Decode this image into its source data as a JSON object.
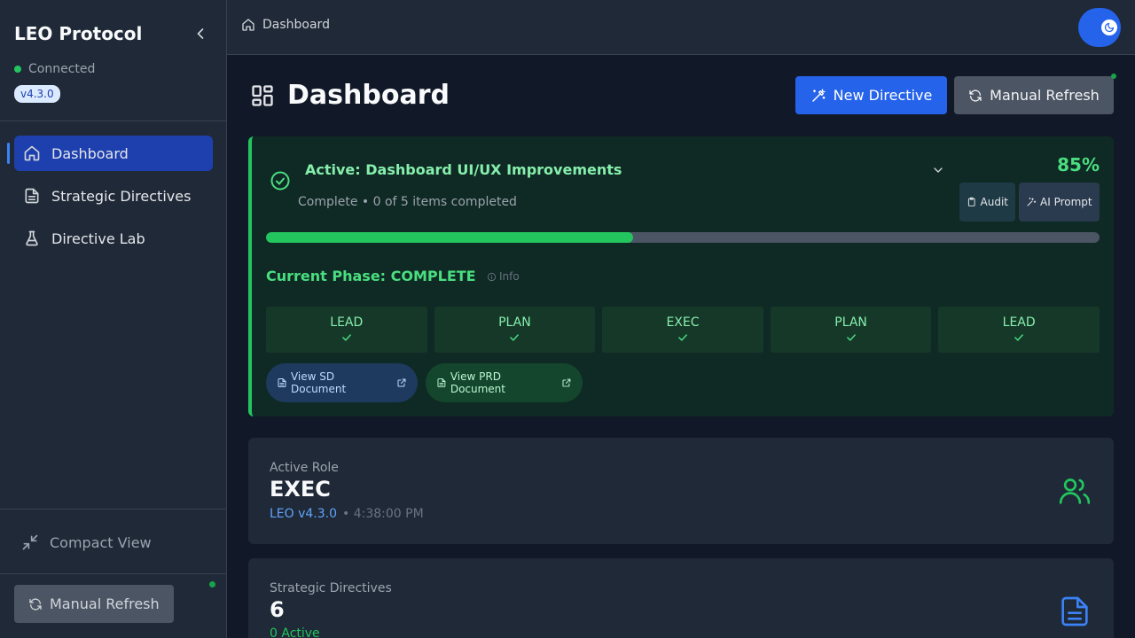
{
  "sidebar": {
    "brand": "LEO Protocol",
    "status": "Connected",
    "version": "v4.3.0",
    "items": [
      {
        "label": "Dashboard",
        "icon": "home-icon",
        "active": true
      },
      {
        "label": "Strategic Directives",
        "icon": "document-icon",
        "active": false
      },
      {
        "label": "Directive Lab",
        "icon": "flask-icon",
        "active": false
      }
    ],
    "compact_view": "Compact View",
    "manual_refresh": "Manual Refresh"
  },
  "topbar": {
    "breadcrumb": "Dashboard",
    "theme_toggle_icon": "moon-icon"
  },
  "header": {
    "title": "Dashboard",
    "new_directive": "New Directive",
    "manual_refresh": "Manual Refresh"
  },
  "active_sd": {
    "title": "Active: Dashboard UI/UX Improvements",
    "subtitle": "Complete • 0 of 5 items completed",
    "percent": "85%",
    "progress_fraction": 0.44,
    "audit": "Audit",
    "ai_prompt": "AI Prompt",
    "phase": "Current Phase: COMPLETE",
    "info": "Info",
    "phases": [
      "LEAD",
      "PLAN",
      "EXEC",
      "PLAN",
      "LEAD"
    ],
    "view_sd": "View SD Document",
    "view_prd": "View PRD Document"
  },
  "active_role": {
    "label": "Active Role",
    "value": "EXEC",
    "version": "LEO v4.3.0",
    "time": "• 4:38:00 PM"
  },
  "strategic_directives": {
    "label": "Strategic Directives",
    "value": "6",
    "active": "0 Active"
  },
  "colors": {
    "accent": "#2563eb",
    "success": "#22c55e",
    "sidebar_bg": "#1f2937",
    "page_bg": "#111827"
  }
}
